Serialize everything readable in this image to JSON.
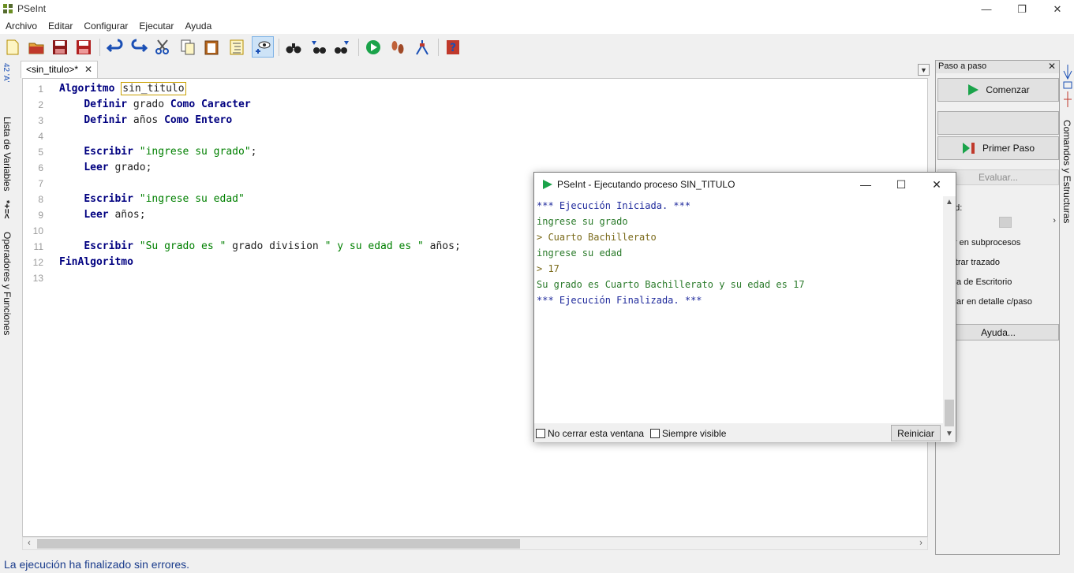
{
  "window": {
    "title": "PSeInt",
    "minimize": "—",
    "restore": "❐",
    "close": "✕"
  },
  "menu": [
    "Archivo",
    "Editar",
    "Configurar",
    "Ejecutar",
    "Ayuda"
  ],
  "toolbar": {
    "icons": [
      "new-file-icon",
      "open-file-icon",
      "save-icon",
      "save-as-icon",
      "undo-icon",
      "redo-icon",
      "cut-icon",
      "copy-icon",
      "paste-icon",
      "indent-icon",
      "debug-view-icon",
      "find-icon",
      "find-previous-icon",
      "find-next-icon",
      "run-icon",
      "step-by-step-icon",
      "flowchart-icon",
      "help-icon"
    ]
  },
  "left_tabs": {
    "variables": "Lista de Variables",
    "operators": "Operadores y Funciones",
    "symbols_top": "42 'A'",
    "symbols_bottom": "*+=<"
  },
  "editor": {
    "tab_label": "<sin_titulo>*",
    "tab_close": "✕",
    "lines": [
      [
        {
          "t": "Algoritmo",
          "c": "kw"
        },
        {
          "t": " ",
          "c": "id"
        },
        {
          "t": "sin_titulo",
          "c": "cur"
        }
      ],
      [
        {
          "t": "    ",
          "c": "id"
        },
        {
          "t": "Definir",
          "c": "kw"
        },
        {
          "t": " grado ",
          "c": "id"
        },
        {
          "t": "Como",
          "c": "kw"
        },
        {
          "t": " ",
          "c": "id"
        },
        {
          "t": "Caracter",
          "c": "kw"
        }
      ],
      [
        {
          "t": "    ",
          "c": "id"
        },
        {
          "t": "Definir",
          "c": "kw"
        },
        {
          "t": " años ",
          "c": "id"
        },
        {
          "t": "Como",
          "c": "kw"
        },
        {
          "t": " ",
          "c": "id"
        },
        {
          "t": "Entero",
          "c": "kw"
        }
      ],
      [],
      [
        {
          "t": "    ",
          "c": "id"
        },
        {
          "t": "Escribir",
          "c": "kw"
        },
        {
          "t": " ",
          "c": "id"
        },
        {
          "t": "\"ingrese su grado\"",
          "c": "str"
        },
        {
          "t": ";",
          "c": "id"
        }
      ],
      [
        {
          "t": "    ",
          "c": "id"
        },
        {
          "t": "Leer",
          "c": "kw"
        },
        {
          "t": " grado;",
          "c": "id"
        }
      ],
      [],
      [
        {
          "t": "    ",
          "c": "id"
        },
        {
          "t": "Escribir",
          "c": "kw"
        },
        {
          "t": " ",
          "c": "id"
        },
        {
          "t": "\"ingrese su edad\"",
          "c": "str"
        }
      ],
      [
        {
          "t": "    ",
          "c": "id"
        },
        {
          "t": "Leer",
          "c": "kw"
        },
        {
          "t": " años;",
          "c": "id"
        }
      ],
      [],
      [
        {
          "t": "    ",
          "c": "id"
        },
        {
          "t": "Escribir",
          "c": "kw"
        },
        {
          "t": " ",
          "c": "id"
        },
        {
          "t": "\"Su grado es \"",
          "c": "str"
        },
        {
          "t": " grado division ",
          "c": "id"
        },
        {
          "t": "\" y su edad es \"",
          "c": "str"
        },
        {
          "t": " años;",
          "c": "id"
        }
      ],
      [
        {
          "t": "FinAlgoritmo",
          "c": "kw"
        }
      ],
      []
    ]
  },
  "status": "La ejecución ha finalizado sin errores.",
  "right_panel": {
    "title": "Paso a paso",
    "close": "✕",
    "btn_start": "Comenzar",
    "btn_first_step": "Primer Paso",
    "btn_evaluate": "Evaluar...",
    "speed_label": "cidad:",
    "opt1": "ntrar en subprocesos",
    "opt2": "Mostrar trazado",
    "opt3": "rueba de Escritorio",
    "opt4": "xplicar en detalle c/paso",
    "btn_help": "Ayuda..."
  },
  "right_tabs": {
    "commands": "Comandos y Estructuras"
  },
  "exec_window": {
    "title": "PSeInt - Ejecutando proceso SIN_TITULO",
    "lines": [
      {
        "t": "*** Ejecución Iniciada. ***",
        "c": "c-sys"
      },
      {
        "t": "ingrese su grado",
        "c": "c-out"
      },
      {
        "t": "> Cuarto Bachillerato",
        "c": "c-in"
      },
      {
        "t": "ingrese su edad",
        "c": "c-out"
      },
      {
        "t": "> 17",
        "c": "c-in"
      },
      {
        "t": "Su grado es Cuarto Bachillerato y su edad es 17",
        "c": "c-out"
      },
      {
        "t": "*** Ejecución Finalizada. ***",
        "c": "c-sys"
      }
    ],
    "chk_keep_open": "No cerrar esta ventana",
    "chk_always_visible": "Siempre visible",
    "btn_restart": "Reiniciar",
    "minimize": "—",
    "maximize": "☐",
    "close": "✕"
  }
}
